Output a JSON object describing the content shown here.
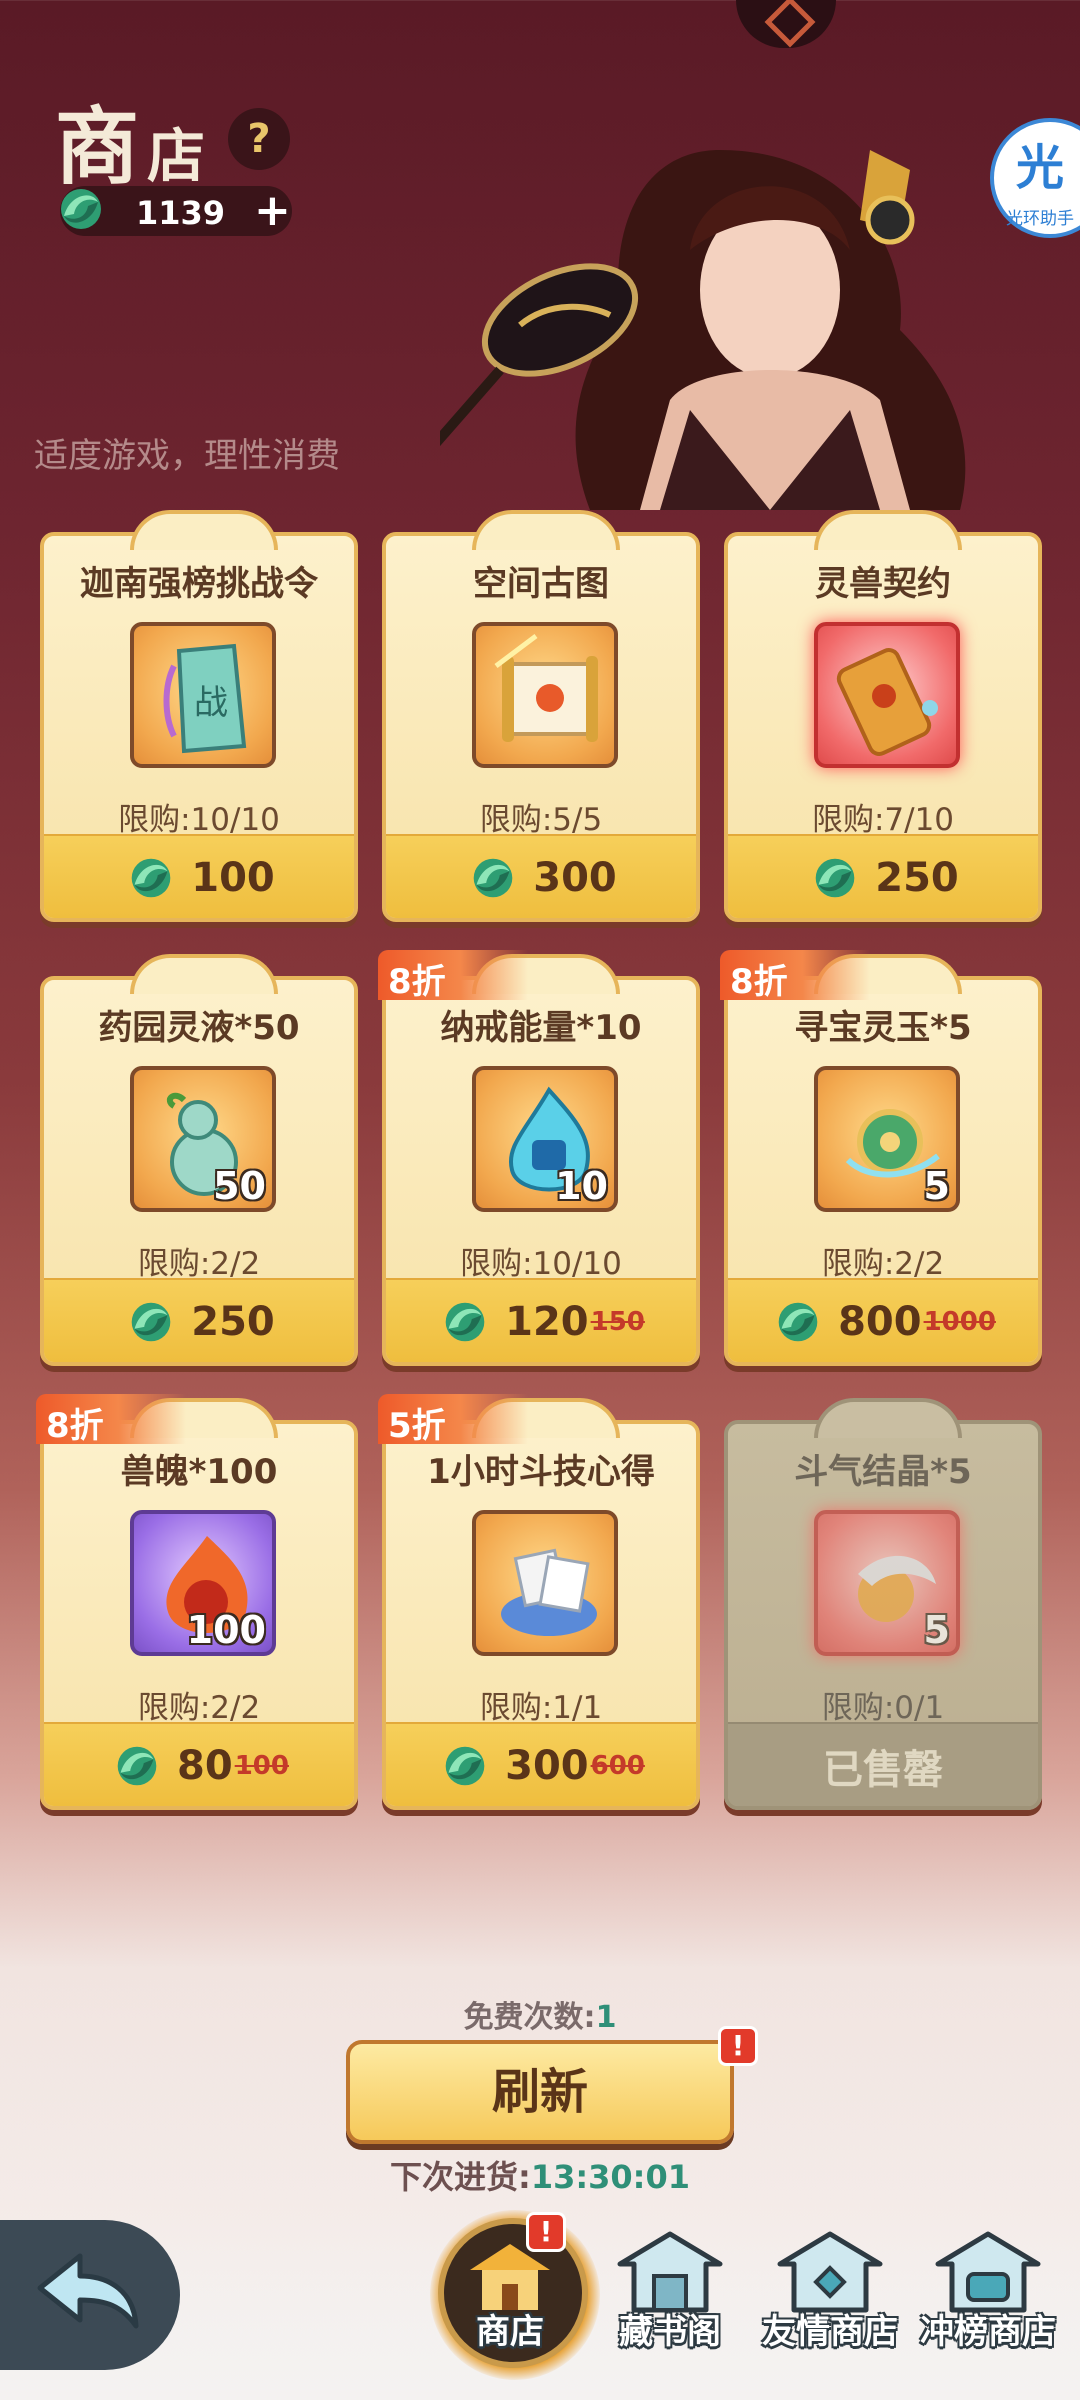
{
  "header": {
    "title_big": "商",
    "title_small": "店",
    "help_glyph": "?",
    "currency_amount": "1139",
    "currency_plus": "+",
    "notice": "适度游戏，理性消费",
    "helper_glyph": "光",
    "helper_label": "光环助手"
  },
  "colors": {
    "background_top": "#5a1a26",
    "card_bg": "#fbeec4",
    "price_bar": "#f1c24a",
    "discount_tag": "#ee5a2a",
    "accent_green": "#2f8f78"
  },
  "items": [
    {
      "name": "迦南强榜挑战令",
      "icon": "battle-token-icon",
      "qty": "",
      "limit": "限购:10/10",
      "price": "100",
      "old_price": "",
      "discount": "",
      "sold_out": false
    },
    {
      "name": "空间古图",
      "icon": "ancient-map-scroll-icon",
      "qty": "",
      "limit": "限购:5/5",
      "price": "300",
      "old_price": "",
      "discount": "",
      "sold_out": false
    },
    {
      "name": "灵兽契约",
      "icon": "beast-contract-scroll-icon",
      "qty": "",
      "limit": "限购:7/10",
      "price": "250",
      "old_price": "",
      "discount": "",
      "sold_out": false
    },
    {
      "name": "药园灵液*50",
      "icon": "elixir-gourd-icon",
      "qty": "50",
      "limit": "限购:2/2",
      "price": "250",
      "old_price": "",
      "discount": "",
      "sold_out": false
    },
    {
      "name": "纳戒能量*10",
      "icon": "ring-energy-flame-icon",
      "qty": "10",
      "limit": "限购:10/10",
      "price": "120",
      "old_price": "150",
      "discount": "8折",
      "sold_out": false
    },
    {
      "name": "寻宝灵玉*5",
      "icon": "treasure-jade-icon",
      "qty": "5",
      "limit": "限购:2/2",
      "price": "800",
      "old_price": "1000",
      "discount": "8折",
      "sold_out": false
    },
    {
      "name": "兽魄*100",
      "icon": "beast-soul-flame-icon",
      "qty": "100",
      "limit": "限购:2/2",
      "price": "80",
      "old_price": "100",
      "discount": "8折",
      "sold_out": false
    },
    {
      "name": "1小时斗技心得",
      "icon": "skill-notes-pile-icon",
      "qty": "",
      "limit": "限购:1/1",
      "price": "300",
      "old_price": "600",
      "discount": "5折",
      "sold_out": false
    },
    {
      "name": "斗气结晶*5",
      "icon": "qi-crystal-icon",
      "qty": "5",
      "limit": "限购:0/1",
      "price": "",
      "old_price": "",
      "discount": "",
      "sold_out": true,
      "sold_label": "已售罄"
    }
  ],
  "footer": {
    "free_label": "免费次数:",
    "free_count": "1",
    "refresh_label": "刷新",
    "refresh_alert": "!",
    "restock_label": "下次进货:",
    "restock_time": "13:30:01"
  },
  "nav": {
    "back_icon": "back-arrow-icon",
    "tabs": [
      {
        "label": "商店",
        "icon": "shop-pavilion-icon",
        "active": true,
        "alert": "!"
      },
      {
        "label": "藏书阁",
        "icon": "library-pavilion-icon",
        "active": false
      },
      {
        "label": "友情商店",
        "icon": "friendship-shop-icon",
        "active": false
      },
      {
        "label": "冲榜商店",
        "icon": "ranking-shop-icon",
        "active": false
      }
    ]
  }
}
